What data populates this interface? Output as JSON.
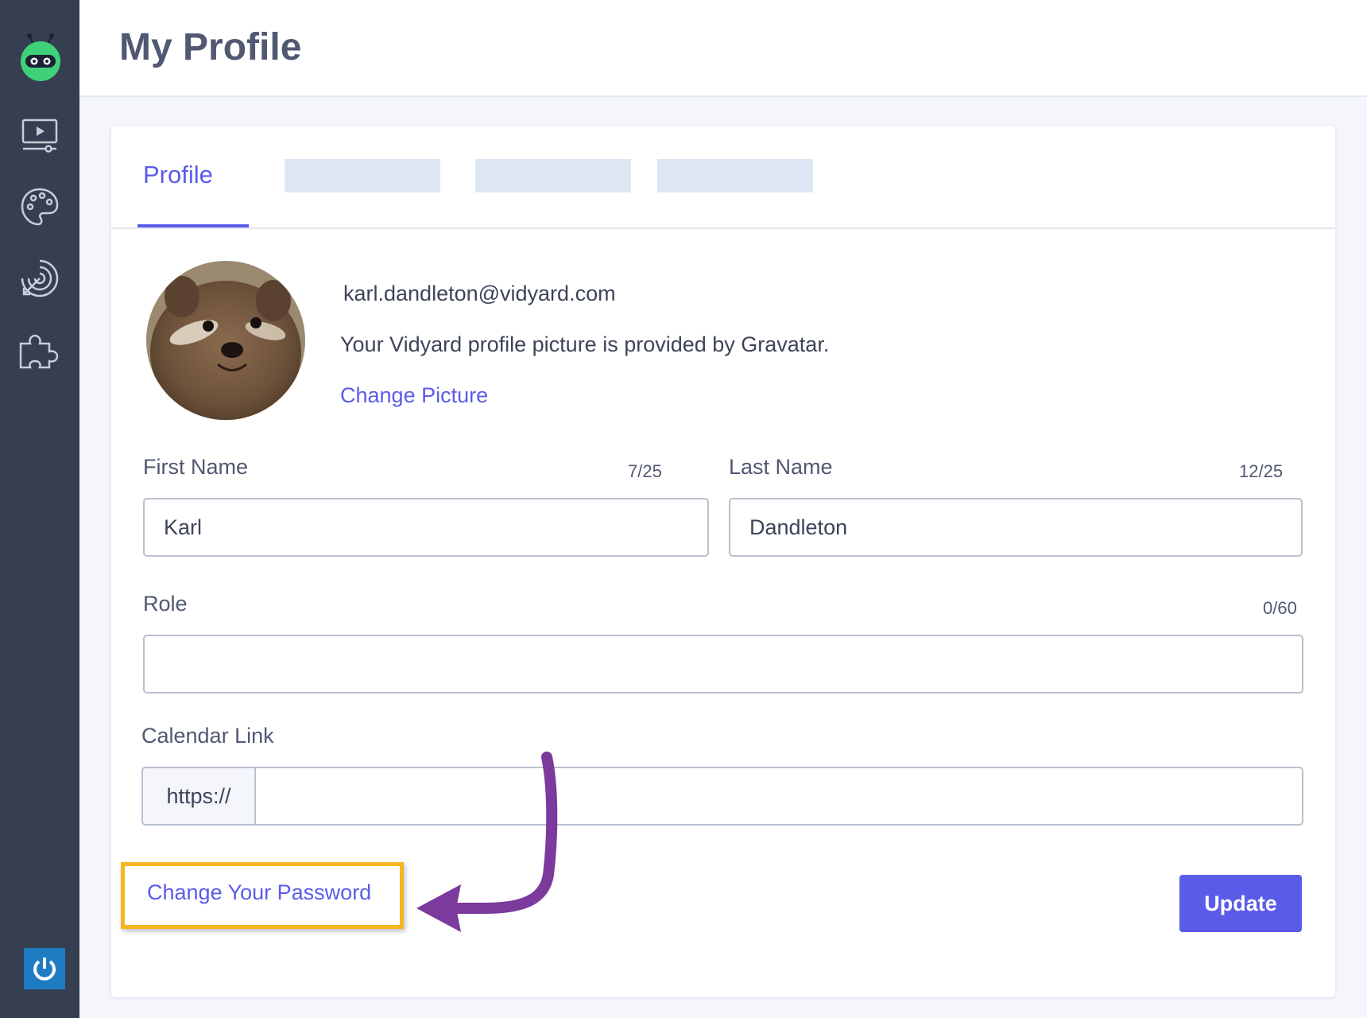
{
  "header": {
    "title": "My Profile"
  },
  "sidebar": {
    "items": [
      {
        "icon": "logo-icon"
      },
      {
        "icon": "video-icon"
      },
      {
        "icon": "palette-icon"
      },
      {
        "icon": "target-icon"
      },
      {
        "icon": "puzzle-icon"
      }
    ],
    "power_icon": "power-icon"
  },
  "tabs": [
    {
      "label": "Profile",
      "active": true
    }
  ],
  "profile": {
    "email": "karl.dandleton@vidyard.com",
    "gravatar_note": "Your Vidyard profile picture is provided by Gravatar.",
    "change_picture": "Change Picture"
  },
  "form": {
    "first_name": {
      "label": "First Name",
      "value": "Karl",
      "counter": "7/25"
    },
    "last_name": {
      "label": "Last Name",
      "value": "Dandleton",
      "counter": "12/25"
    },
    "role": {
      "label": "Role",
      "value": "",
      "counter": "0/60"
    },
    "calendar_link": {
      "label": "Calendar Link",
      "prefix": "https://",
      "value": ""
    }
  },
  "actions": {
    "change_password": "Change Your Password",
    "update": "Update"
  },
  "colors": {
    "accent": "#5b5bea",
    "sidebar": "#363e51",
    "highlight": "#f5b61f",
    "arrow": "#7b3a9c"
  }
}
